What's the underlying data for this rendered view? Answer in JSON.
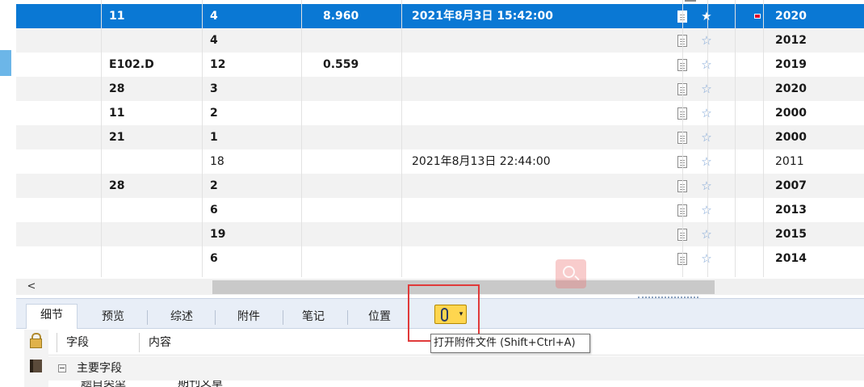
{
  "table": {
    "rows": [
      {
        "c1": "11",
        "c2": "4",
        "c3": "8.960",
        "c4": "2021年8月3日 15:42:00",
        "c9": "2020",
        "bold": true,
        "selected": true,
        "flag": true,
        "starred": true
      },
      {
        "c1": "",
        "c2": "4",
        "c3": "",
        "c4": "",
        "c9": "2012",
        "bold": true
      },
      {
        "c1": "E102.D",
        "c2": "12",
        "c3": "0.559",
        "c4": "",
        "c9": "2019",
        "bold": true
      },
      {
        "c1": "28",
        "c2": "3",
        "c3": "",
        "c4": "",
        "c9": "2020",
        "bold": true
      },
      {
        "c1": "11",
        "c2": "2",
        "c3": "",
        "c4": "",
        "c9": "2000",
        "bold": true
      },
      {
        "c1": "21",
        "c2": "1",
        "c3": "",
        "c4": "",
        "c9": "2000",
        "bold": true
      },
      {
        "c1": "",
        "c2": "18",
        "c3": "",
        "c4": "2021年8月13日 22:44:00",
        "c9": "2011",
        "bold": false
      },
      {
        "c1": "28",
        "c2": "2",
        "c3": "",
        "c4": "",
        "c9": "2007",
        "bold": true
      },
      {
        "c1": "",
        "c2": "6",
        "c3": "",
        "c4": "",
        "c9": "2013",
        "bold": true
      },
      {
        "c1": "",
        "c2": "19",
        "c3": "",
        "c4": "",
        "c9": "2015",
        "bold": true
      },
      {
        "c1": "",
        "c2": "6",
        "c3": "",
        "c4": "",
        "c9": "2014",
        "bold": true
      }
    ]
  },
  "scrollbar": {
    "left_arrow": "<"
  },
  "tabs": {
    "details": "细节",
    "preview": "预览",
    "summary": "综述",
    "attachments": "附件",
    "notes": "笔记",
    "location": "位置"
  },
  "toolbar": {
    "dropdown_glyph": "▾"
  },
  "tooltip": {
    "text": "打开附件文件 (Shift+Ctrl+A)"
  },
  "detail": {
    "col_field": "字段",
    "col_content": "内容",
    "group_main_fields": "主要字段",
    "next_row_partial_a": "题目类型",
    "next_row_partial_b": "期刊文章"
  },
  "colors": {
    "selection": "#0a78d4",
    "accent_highlight": "#e03a3a",
    "attach_button": "#ffd64f"
  }
}
